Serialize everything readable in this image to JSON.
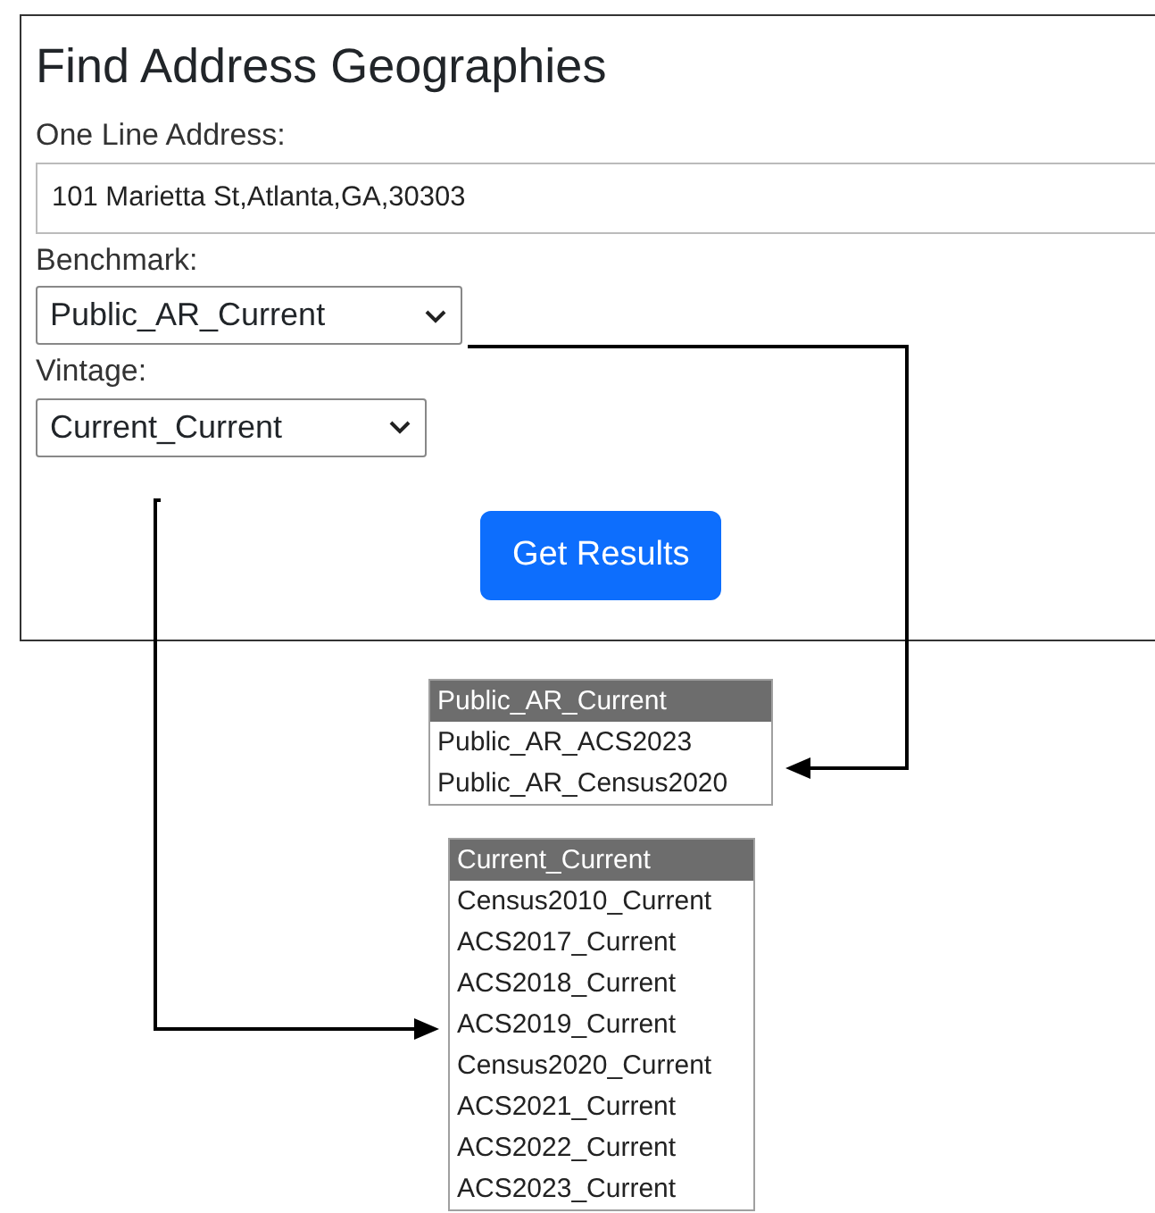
{
  "title": "Find Address Geographies",
  "address": {
    "label": "One Line Address:",
    "value": "101 Marietta St,Atlanta,GA,30303"
  },
  "benchmark": {
    "label": "Benchmark:",
    "value": "Public_AR_Current",
    "options": [
      {
        "label": "Public_AR_Current",
        "selected": true
      },
      {
        "label": "Public_AR_ACS2023",
        "selected": false
      },
      {
        "label": "Public_AR_Census2020",
        "selected": false
      }
    ]
  },
  "vintage": {
    "label": "Vintage:",
    "value": "Current_Current",
    "options": [
      {
        "label": "Current_Current",
        "selected": true
      },
      {
        "label": "Census2010_Current",
        "selected": false
      },
      {
        "label": "ACS2017_Current",
        "selected": false
      },
      {
        "label": "ACS2018_Current",
        "selected": false
      },
      {
        "label": "ACS2019_Current",
        "selected": false
      },
      {
        "label": "Census2020_Current",
        "selected": false
      },
      {
        "label": "ACS2021_Current",
        "selected": false
      },
      {
        "label": "ACS2022_Current",
        "selected": false
      },
      {
        "label": "ACS2023_Current",
        "selected": false
      }
    ]
  },
  "button": "Get Results"
}
